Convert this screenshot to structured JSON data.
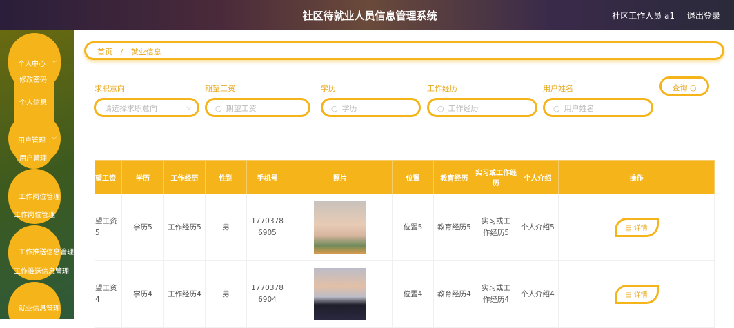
{
  "header": {
    "title": "社区待就业人员信息管理系统",
    "user": "社区工作人员 a1",
    "logout": "退出登录"
  },
  "sidebar": {
    "menus": [
      {
        "label": "个人中心",
        "children": [
          "修改密码",
          "个人信息"
        ]
      },
      {
        "label": "用户管理",
        "children": [
          "用户管理"
        ]
      },
      {
        "label": "工作岗位管理",
        "children": [
          "工作岗位管理"
        ]
      },
      {
        "label": "工作推送信息管理",
        "children": [
          "工作推送信息管理"
        ]
      },
      {
        "label": "就业信息管理",
        "children": []
      }
    ]
  },
  "breadcrumb": {
    "home": "首页",
    "sep": "/",
    "current": "就业信息"
  },
  "filters": [
    {
      "label": "求职意向",
      "placeholder": "请选择求职意向"
    },
    {
      "label": "期望工资",
      "placeholder": "期望工资"
    },
    {
      "label": "学历",
      "placeholder": "学历"
    },
    {
      "label": "工作经历",
      "placeholder": "工作经历"
    },
    {
      "label": "用户姓名",
      "placeholder": "用户姓名"
    }
  ],
  "query_label": "查询",
  "table": {
    "headers": [
      "望工资",
      "学历",
      "工作经历",
      "性别",
      "手机号",
      "照片",
      "位置",
      "教育经历",
      "实习或工作经历",
      "个人介绍",
      "操作"
    ],
    "rows": [
      {
        "salary": "望工资5",
        "edu": "学历5",
        "work": "工作经历5",
        "gender": "男",
        "phone": "17703786905",
        "location": "位置5",
        "edu_exp": "教育经历5",
        "intern": "实习或工作经历5",
        "intro": "个人介绍5",
        "action": "详情"
      },
      {
        "salary": "望工资4",
        "edu": "学历4",
        "work": "工作经历4",
        "gender": "男",
        "phone": "17703786904",
        "location": "位置4",
        "edu_exp": "教育经历4",
        "intern": "实习或工作经历4",
        "intro": "个人介绍4",
        "action": "详情"
      }
    ]
  },
  "colors": {
    "accent": "#f4b41a"
  }
}
